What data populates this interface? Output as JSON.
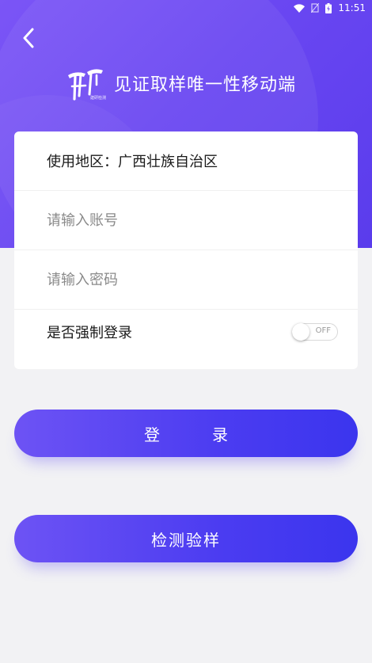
{
  "status_bar": {
    "time": "11:51",
    "icons": [
      "wifi-icon",
      "no-sim-icon",
      "battery-charging-icon"
    ]
  },
  "header": {
    "back_icon": "chevron-left-icon",
    "logo_small_text": "建研检测",
    "title": "见证取样唯一性移动端"
  },
  "form": {
    "region_label": "使用地区：",
    "region_value": "广西壮族自治区",
    "account_placeholder": "请输入账号",
    "password_placeholder": "请输入密码",
    "force_login_label": "是否强制登录",
    "force_login_toggle_text": "OFF",
    "force_login_on": false
  },
  "buttons": {
    "login_label": "登录",
    "test_label": "检测验样"
  },
  "colors": {
    "header_gradient_start": "#7b55f6",
    "header_gradient_end": "#5a3cec",
    "button_gradient_start": "#6d53f4",
    "button_gradient_end": "#3b35ee",
    "page_background": "#f2f2f4"
  }
}
